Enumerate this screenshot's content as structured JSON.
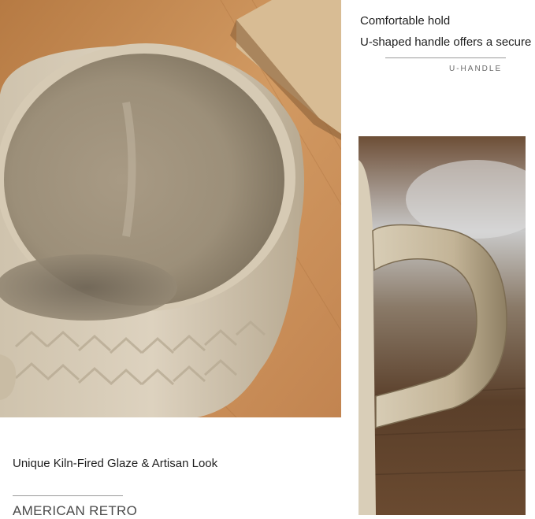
{
  "top_right": {
    "headline": "Comfortable hold",
    "subline": "U-shaped handle offers a secure",
    "label": "U-HANDLE"
  },
  "bottom_left": {
    "caption": "Unique Kiln-Fired Glaze & Artisan Look",
    "label": "AMERICAN RETRO"
  },
  "photos": [
    {
      "subject": "ceramic-bowl-mug-interior"
    },
    {
      "subject": "ceramic-mug-u-handle"
    }
  ],
  "colors": {
    "wood": "#c58a52",
    "glaze": "#b3a690",
    "glaze_dark": "#8c7f6a",
    "background": "#ffffff"
  }
}
